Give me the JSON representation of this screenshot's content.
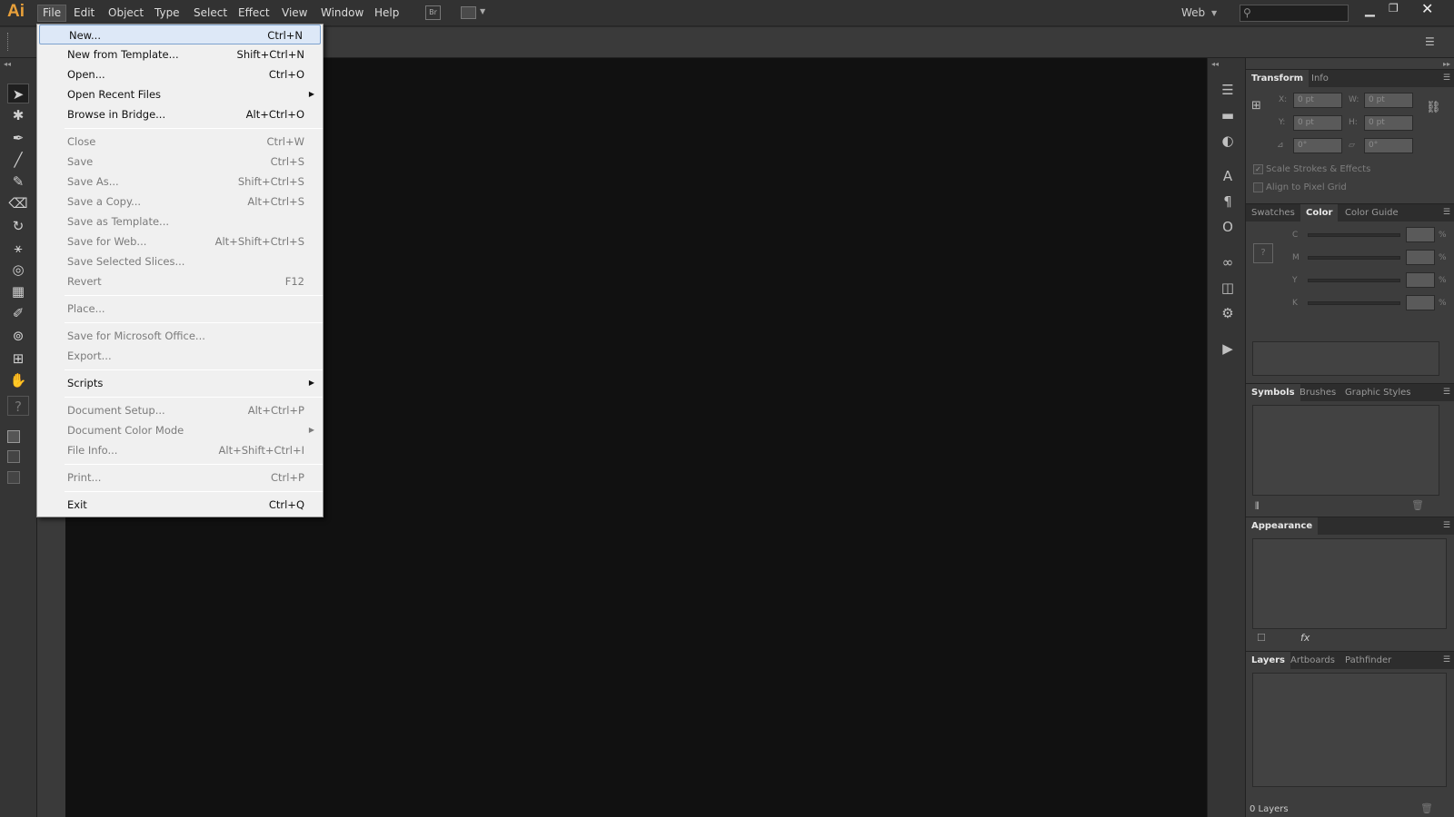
{
  "app": {
    "logo": "Ai",
    "workspace": "Web"
  },
  "menubar": [
    "File",
    "Edit",
    "Object",
    "Type",
    "Select",
    "Effect",
    "View",
    "Window",
    "Help"
  ],
  "bridge_btn": "Br",
  "file_menu": {
    "items": [
      {
        "label": "New...",
        "shortcut": "Ctrl+N",
        "enabled": true,
        "highlight": true
      },
      {
        "label": "New from Template...",
        "shortcut": "Shift+Ctrl+N",
        "enabled": true
      },
      {
        "label": "Open...",
        "shortcut": "Ctrl+O",
        "enabled": true
      },
      {
        "label": "Open Recent Files",
        "shortcut": "",
        "enabled": true,
        "submenu": true
      },
      {
        "label": "Browse in Bridge...",
        "shortcut": "Alt+Ctrl+O",
        "enabled": true
      },
      {
        "label": "Close",
        "shortcut": "Ctrl+W",
        "enabled": false
      },
      {
        "label": "Save",
        "shortcut": "Ctrl+S",
        "enabled": false
      },
      {
        "label": "Save As...",
        "shortcut": "Shift+Ctrl+S",
        "enabled": false
      },
      {
        "label": "Save a Copy...",
        "shortcut": "Alt+Ctrl+S",
        "enabled": false
      },
      {
        "label": "Save as Template...",
        "shortcut": "",
        "enabled": false
      },
      {
        "label": "Save for Web...",
        "shortcut": "Alt+Shift+Ctrl+S",
        "enabled": false
      },
      {
        "label": "Save Selected Slices...",
        "shortcut": "",
        "enabled": false
      },
      {
        "label": "Revert",
        "shortcut": "F12",
        "enabled": false
      },
      {
        "label": "Place...",
        "shortcut": "",
        "enabled": false
      },
      {
        "label": "Save for Microsoft Office...",
        "shortcut": "",
        "enabled": false
      },
      {
        "label": "Export...",
        "shortcut": "",
        "enabled": false
      },
      {
        "label": "Scripts",
        "shortcut": "",
        "enabled": true,
        "submenu": true
      },
      {
        "label": "Document Setup...",
        "shortcut": "Alt+Ctrl+P",
        "enabled": false
      },
      {
        "label": "Document Color Mode",
        "shortcut": "",
        "enabled": false,
        "submenu": true
      },
      {
        "label": "File Info...",
        "shortcut": "Alt+Shift+Ctrl+I",
        "enabled": false
      },
      {
        "label": "Print...",
        "shortcut": "Ctrl+P",
        "enabled": false
      },
      {
        "label": "Exit",
        "shortcut": "Ctrl+Q",
        "enabled": true
      }
    ]
  },
  "transform": {
    "tabs": [
      "Transform",
      "Info"
    ],
    "x_label": "X:",
    "y_label": "Y:",
    "w_label": "W:",
    "h_label": "H:",
    "x": "0 pt",
    "y": "0 pt",
    "w": "0 pt",
    "h": "0 pt",
    "angle": "0°",
    "shear": "0°",
    "scale_strokes": "Scale Strokes & Effects",
    "align_pixel": "Align to Pixel Grid"
  },
  "color": {
    "tabs": [
      "Swatches",
      "Color",
      "Color Guide"
    ],
    "channels": [
      "C",
      "M",
      "Y",
      "K"
    ],
    "unit": "%"
  },
  "symbols": {
    "tabs": [
      "Symbols",
      "Brushes",
      "Graphic Styles"
    ]
  },
  "appearance": {
    "title": "Appearance",
    "fx": "fx"
  },
  "layers": {
    "tabs": [
      "Layers",
      "Artboards",
      "Pathfinder"
    ],
    "count": "0 Layers"
  },
  "colors": {
    "accent": "#e8a03a",
    "menu_bg": "#f0f0f0",
    "canvas": "#111111"
  }
}
